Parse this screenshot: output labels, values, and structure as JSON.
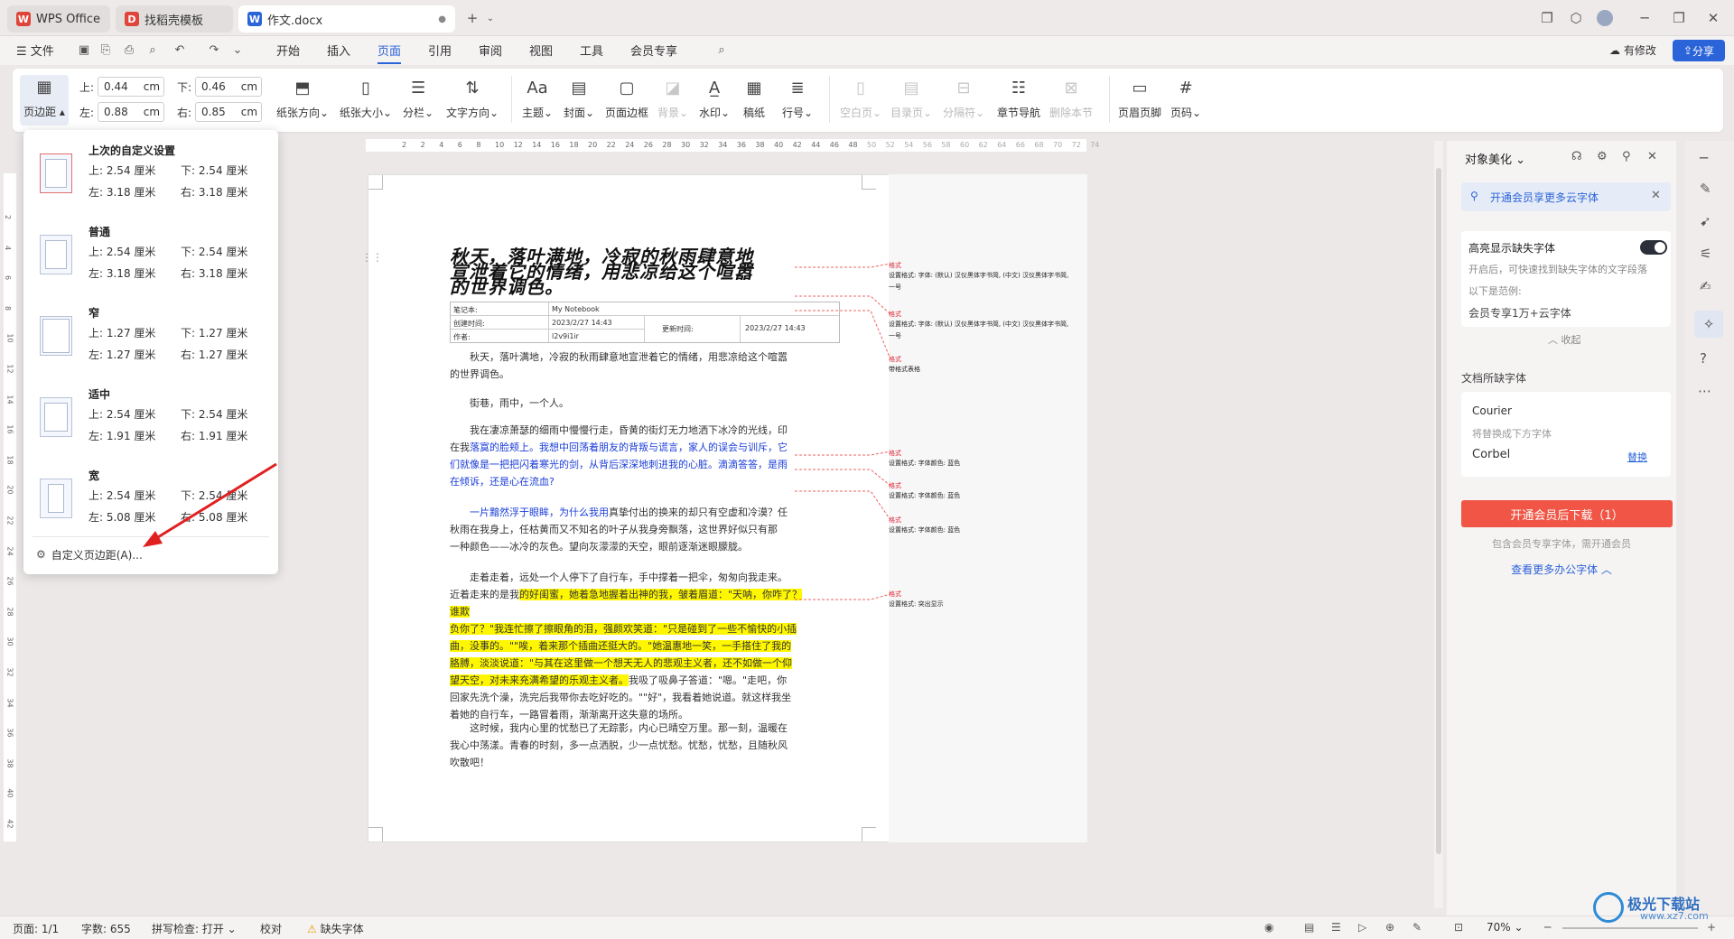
{
  "tabs": [
    {
      "label": "WPS Office"
    },
    {
      "label": "找稻壳模板"
    },
    {
      "label": "作文.docx"
    }
  ],
  "menu": {
    "file": "文件",
    "items": [
      "开始",
      "插入",
      "页面",
      "引用",
      "审阅",
      "视图",
      "工具",
      "会员专享"
    ],
    "active_index": 2,
    "has_changes": "有修改",
    "share": "分享"
  },
  "ribbon": {
    "margins_btn": "页边距",
    "top_label": "上:",
    "top_value": "0.44",
    "top_unit": "cm",
    "bottom_label": "下:",
    "bottom_value": "0.46",
    "bottom_unit": "cm",
    "left_label": "左:",
    "left_value": "0.88",
    "left_unit": "cm",
    "right_label": "右:",
    "right_value": "0.85",
    "right_unit": "cm",
    "buttons": [
      "纸张方向",
      "纸张大小",
      "分栏",
      "文字方向",
      "主题",
      "封面",
      "页面边框",
      "背景",
      "水印",
      "稿纸",
      "行号",
      "空白页",
      "目录页",
      "分隔符",
      "章节导航",
      "删除本节",
      "页眉页脚",
      "页码"
    ]
  },
  "ruler": {
    "h_ticks": [
      "2",
      "2",
      "4",
      "6",
      "8",
      "10",
      "12",
      "14",
      "16",
      "18",
      "20",
      "22",
      "24",
      "26",
      "28",
      "30",
      "32",
      "34",
      "36",
      "38",
      "40",
      "42",
      "44",
      "46",
      "48",
      "50",
      "52",
      "54",
      "56",
      "58",
      "60",
      "62",
      "64",
      "66",
      "68",
      "70",
      "72",
      "74"
    ],
    "v_ticks": [
      "2",
      "4",
      "6",
      "8",
      "10",
      "12",
      "14",
      "16",
      "18",
      "20",
      "22",
      "24",
      "26",
      "28",
      "30",
      "32",
      "34",
      "36",
      "38",
      "40",
      "42"
    ]
  },
  "dropdown": {
    "presets": [
      {
        "name": "上次的自定义设置",
        "top": "上: 2.54 厘米",
        "bottom": "下: 2.54 厘米",
        "left": "左: 3.18 厘米",
        "right": "右: 3.18 厘米"
      },
      {
        "name": "普通",
        "top": "上: 2.54 厘米",
        "bottom": "下: 2.54 厘米",
        "left": "左: 3.18 厘米",
        "right": "右: 3.18 厘米"
      },
      {
        "name": "窄",
        "top": "上: 1.27 厘米",
        "bottom": "下: 1.27 厘米",
        "left": "左: 1.27 厘米",
        "right": "右: 1.27 厘米"
      },
      {
        "name": "适中",
        "top": "上: 2.54 厘米",
        "bottom": "下: 2.54 厘米",
        "left": "左: 1.91 厘米",
        "right": "右: 1.91 厘米"
      },
      {
        "name": "宽",
        "top": "上: 2.54 厘米",
        "bottom": "下: 2.54 厘米",
        "left": "左: 5.08 厘米",
        "right": "右: 5.08 厘米"
      }
    ],
    "custom": "自定义页边距(A)..."
  },
  "document": {
    "title1": "秋天，落叶满地，冷寂的秋雨肆意地",
    "title2": "宣泄着它的情绪，用悲凉给这个喧嚣",
    "title3": "的世界调色。",
    "meta": {
      "notebook_label": "笔记本:",
      "notebook_value": "My Notebook",
      "created_label": "创建时间:",
      "created_value": "2023/2/27 14:43",
      "updated_label": "更新时间:",
      "updated_value": "2023/2/27 14:43",
      "author_label": "作者:",
      "author_value": "l2v9i1ir"
    },
    "p1a": "秋天，落叶满地，冷寂的秋雨肆意地宣泄着它的情绪，用悲凉给这个喧嚣",
    "p1b": "的世界调色。",
    "p2": "街巷，雨中，一个人。",
    "p3a": "我在凄凉萧瑟的细雨中慢慢行走，昏黄的街灯无力地洒下冰冷的光线，印",
    "p3b_pre": "在我",
    "p3b_blue": "落寞的脸颊上。我想中回荡着朋友的背叛与谎言，家人的误会与训斥，它",
    "p3c": "们就像是一把把闪着寒光的剑，从背后深深地刺进我的心脏。滴滴答答，是雨",
    "p3d": "在倾诉，还是心在流血?",
    "p4a_blue": "一片黯然浮于眼眸，为什么我用",
    "p4a_rest": "真挚付出的换来的却只有空虚和冷漠？任",
    "p4b": "秋雨在我身上，任枯黄而又不知名的叶子从我身旁飘落，这世界好似只有那",
    "p4c": "一种颜色——冰冷的灰色。望向灰濛濛的天空，眼前逐渐迷眼朦胧。",
    "p5a": "走着走着，远处一个人停下了自行车，手中撑着一把伞，匆匆向我走来。",
    "p5b_pre": "近着走来的是我",
    "p5b_hl": "的好闺蜜，她着急地握着出神的我，皱着眉道：\"天呐，你咋了？谁欺",
    "p5c": "负你了？\"我连忙擦了擦眼角的泪，强颜欢笑道：\"只是碰到了一些不愉快的小插",
    "p5d": "曲，没事的。\"\"唉，着来那个插曲还挺大的。\"她温惠地一笑，一手搭住了我的",
    "p5e": "胳膊，淡淡说道：\"与其在这里做一个想天无人的悲观主义者，还不如做一个仰",
    "p5f_hl": "望天空，对未来充满希望的乐观主义者。",
    "p5f_rest": "我吸了吸鼻子答道：\"嗯。\"走吧，你",
    "p5g": "回家先洗个澡，洗完后我带你去吃好吃的。\"\"好\"，我看着她说道。就这样我坐",
    "p5h": "着她的自行车，一路冒着雨，渐渐离开这失意的场所。",
    "p6a": "这时候，我内心里的忧愁已了无踪影，内心已晴空万里。那一刻，温暖在",
    "p6b": "我心中荡漾。青春的时刻，多一点洒脱，少一点忧愁。忧愁，忧愁，且随秋风",
    "p6c": "吹散吧！",
    "comments": [
      {
        "author": "格式",
        "text": "设置格式: 字体: (默认) 汉仪黑体字书简, (中文) 汉仪黑体字书简, 一号"
      },
      {
        "author": "格式",
        "text": "设置格式: 字体: (默认) 汉仪黑体字书简, (中文) 汉仪黑体字书简, 一号"
      },
      {
        "author": "格式",
        "text": "带格式表格"
      },
      {
        "author": "格式",
        "text": "设置格式: 字体颜色: 蓝色"
      },
      {
        "author": "格式",
        "text": "设置格式: 字体颜色: 蓝色"
      },
      {
        "author": "格式",
        "text": "设置格式: 字体颜色: 蓝色"
      },
      {
        "author": "格式",
        "text": "设置格式: 突出显示"
      }
    ]
  },
  "panel": {
    "title": "对象美化",
    "vip_banner": "开通会员享更多云字体",
    "highlight_label": "高亮显示缺失字体",
    "highlight_desc": "开启后，可快速找到缺失字体的文字段落",
    "example_label": "以下是范例:",
    "example_text": "会员专享1万+云字体",
    "collapse": "收起",
    "missing_title": "文档所缺字体",
    "missing_font": "Courier",
    "replace_hint": "将替换成下方字体",
    "replace_font": "Corbel",
    "replace_link": "替换",
    "download_btn": "开通会员后下载（1）",
    "download_note": "包含会员专享字体，需开通会员",
    "more_link": "查看更多办公字体"
  },
  "status": {
    "page": "页面: 1/1",
    "words": "字数: 655",
    "spell": "拼写检查: 打开",
    "proof": "校对",
    "missing_font": "缺失字体",
    "zoom": "70%"
  },
  "watermark": "极光下载站",
  "watermark_url": "www.xz7.com",
  "colors": {
    "accent": "#2b63d9",
    "download": "#f05545",
    "highlight": "#fff700",
    "blue_text": "#1a3dd8"
  }
}
